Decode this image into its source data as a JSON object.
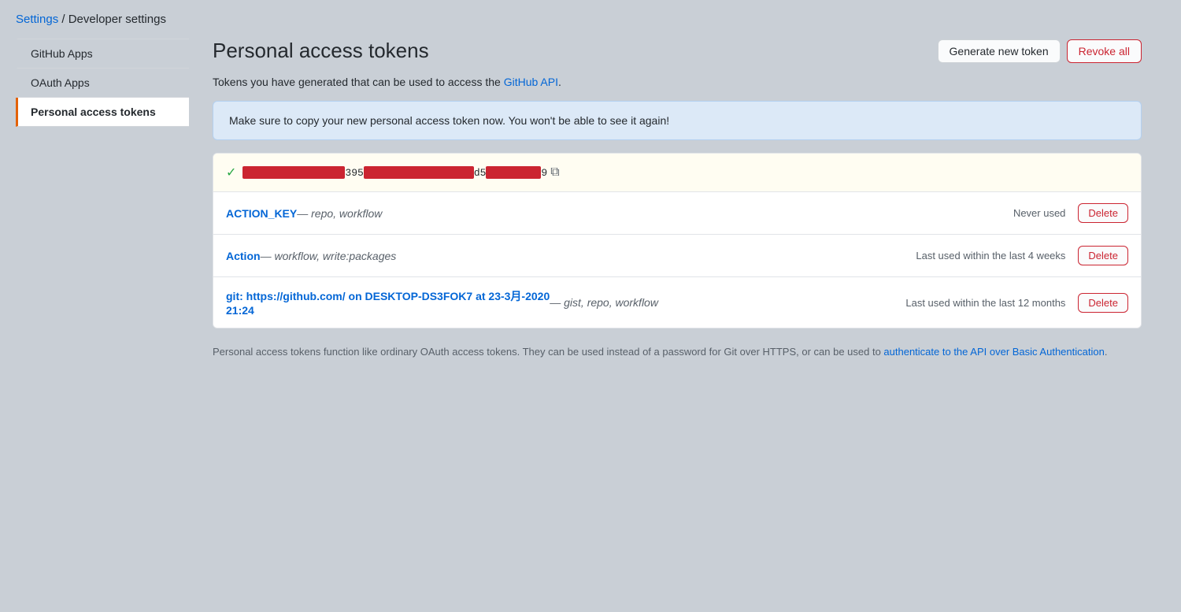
{
  "breadcrumb": {
    "settings_label": "Settings",
    "separator": "/",
    "current_label": "Developer settings"
  },
  "sidebar": {
    "items": [
      {
        "id": "github-apps",
        "label": "GitHub Apps",
        "active": false
      },
      {
        "id": "oauth-apps",
        "label": "OAuth Apps",
        "active": false
      },
      {
        "id": "personal-access-tokens",
        "label": "Personal access tokens",
        "active": true
      }
    ]
  },
  "main": {
    "page_title": "Personal access tokens",
    "buttons": {
      "generate_label": "Generate new token",
      "revoke_all_label": "Revoke all"
    },
    "description_before": "Tokens you have generated that can be used to access the ",
    "github_api_link": "GitHub API",
    "description_after": ".",
    "alert_message": "Make sure to copy your new personal access token now. You won't be able to see it again!",
    "token_display": {
      "check_icon": "✓",
      "token_part_mid": "395",
      "token_part_end": "d5",
      "token_part_last": "9",
      "copy_icon": "⧉"
    },
    "tokens": [
      {
        "id": "action-key",
        "name": "ACTION_KEY",
        "separator": " — ",
        "scopes": "repo, workflow",
        "usage": "Never used",
        "delete_label": "Delete"
      },
      {
        "id": "action",
        "name": "Action",
        "separator": " — ",
        "scopes": "workflow, write:packages",
        "usage": "Last used within the last 4 weeks",
        "delete_label": "Delete"
      },
      {
        "id": "git-desktop",
        "name": "git: https://github.com/ on DESKTOP-DS3FOK7 at 23-3月-2020 21:24",
        "separator": " — ",
        "scopes": "gist, repo, workflow",
        "usage": "Last used within the last 12 months",
        "delete_label": "Delete"
      }
    ],
    "footer": {
      "text_before": "Personal access tokens function like ordinary OAuth access tokens. They can be used instead of a password for Git over HTTPS, or can be used to ",
      "link_label": "authenticate to the API over Basic Authentication",
      "text_after": "."
    }
  }
}
